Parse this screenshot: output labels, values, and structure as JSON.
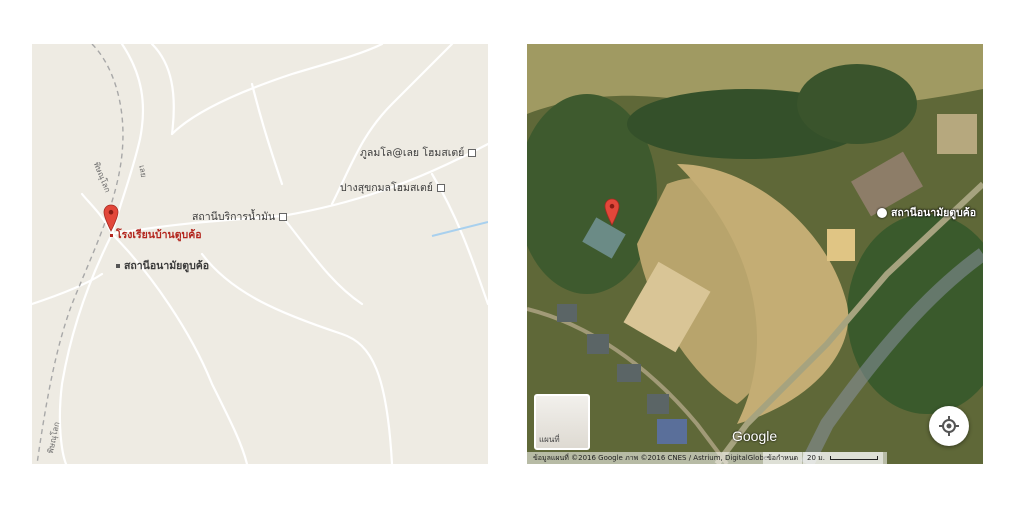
{
  "road_map": {
    "road_label_vertical": "พิษณุโลก",
    "road_label_short": "เลย",
    "road_label_bottom": "พิษณุโลก",
    "gas_station": "สถานีบริการน้ำมัน",
    "homestay_1": "ภูลมโล@เลย โฮมสเตย์",
    "homestay_2": "ปางสุขกมลโฮมสเตย์",
    "school": "โรงเรียนบ้านตูบค้อ",
    "health_station": "สถานีอนามัยตูบค้อ"
  },
  "satellite_map": {
    "health_station": "สถานีอนามัยตูบค้อ",
    "map_type_label": "แผนที่",
    "google_logo": "Google",
    "attribution": "ข้อมูลแผนที่ ©2016 Google ภาพ ©2016 CNES / Astrium, DigitalGlobe",
    "terms": "ข้อกำหนด",
    "scale_label": "20 ม."
  },
  "colors": {
    "road_bg": "#eeebe3",
    "pin_red": "#e2473a",
    "school_label": "#b3261e"
  },
  "icons": [
    "map-pin-icon",
    "poi-icon",
    "my-location-icon"
  ]
}
